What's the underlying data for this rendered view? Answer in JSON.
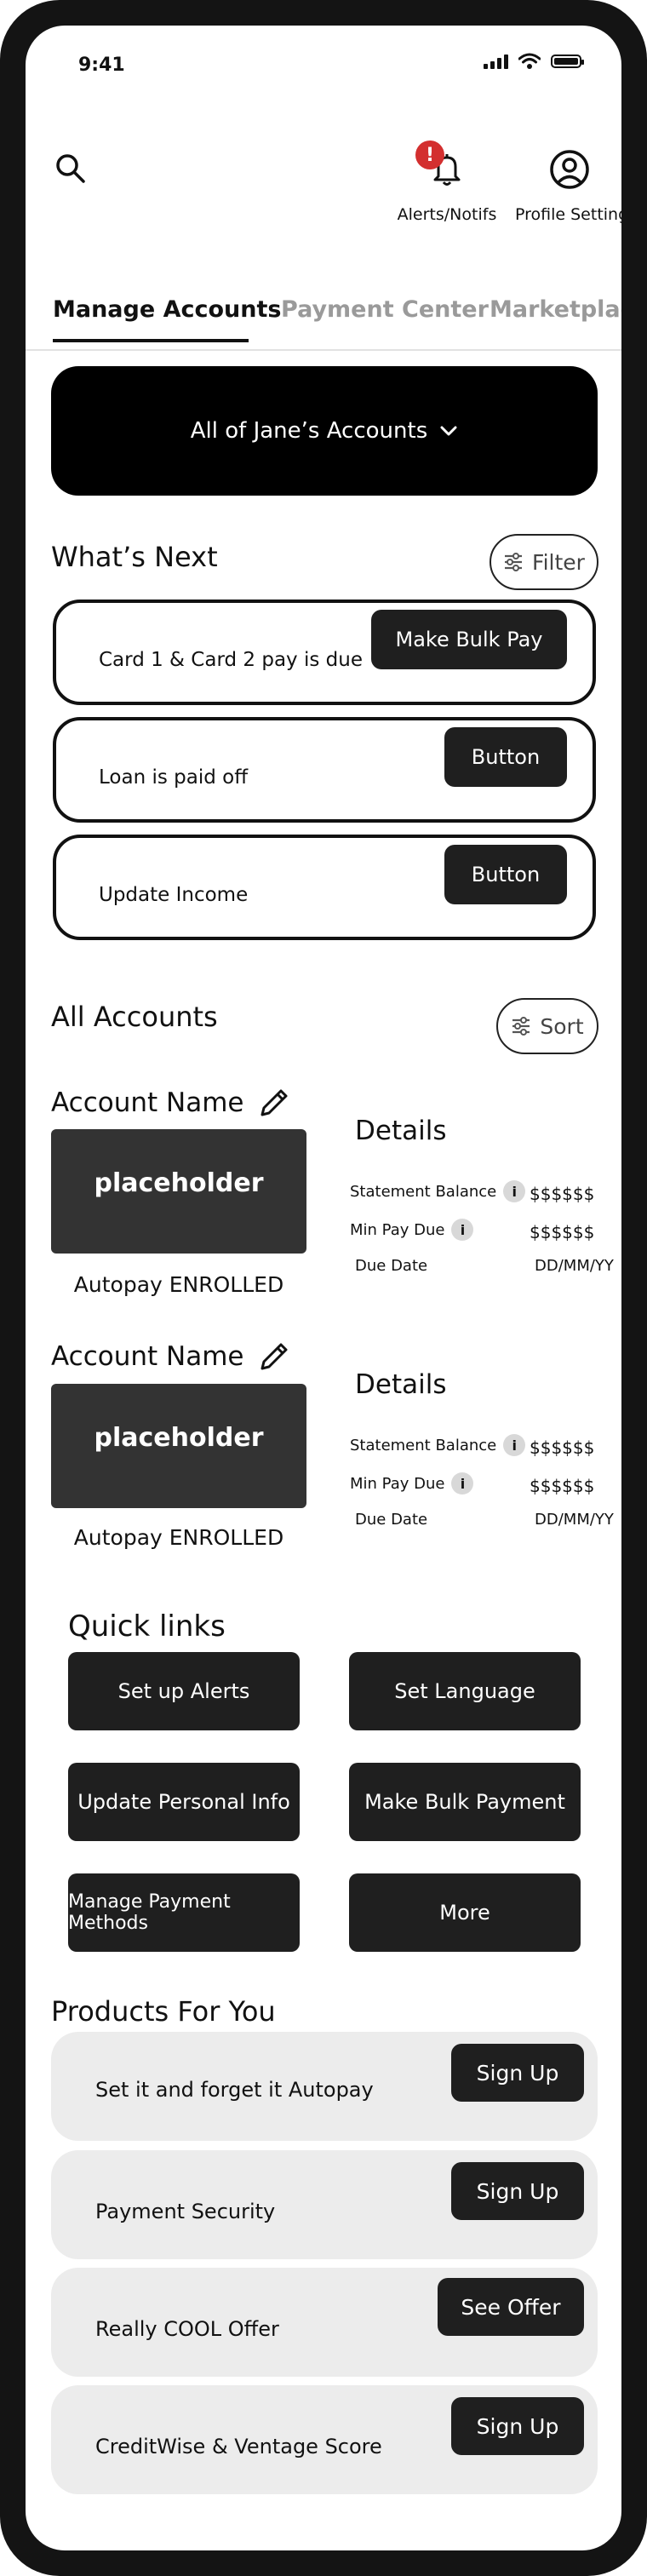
{
  "status_bar": {
    "time": "9:41"
  },
  "header": {
    "alerts_label": "Alerts/Notifs",
    "alerts_badge": "!",
    "profile_label": "Profile Settings"
  },
  "tabs": [
    {
      "label": "Manage Accounts"
    },
    {
      "label": "Payment Center"
    },
    {
      "label": "Marketplace"
    }
  ],
  "account_selector": {
    "label": "All of Jane’s Accounts"
  },
  "whats_next": {
    "title": "What’s Next",
    "filter_label": "Filter",
    "items": [
      {
        "text": "Card 1 & Card 2 pay is due",
        "button": "Make Bulk Pay"
      },
      {
        "text": "Loan is paid off",
        "button": "Button"
      },
      {
        "text": "Update Income",
        "button": "Button"
      }
    ]
  },
  "all_accounts": {
    "title": "All Accounts",
    "sort_label": "Sort",
    "accounts": [
      {
        "name": "Account Name",
        "image_text": "placeholder",
        "autopay": "Autopay ENROLLED",
        "details_title": "Details",
        "rows": [
          {
            "label": "Statement Balance",
            "value": "$$$$$$"
          },
          {
            "label": "Min Pay Due",
            "value": "$$$$$$"
          },
          {
            "label": "Due Date",
            "value": "DD/MM/YY"
          }
        ]
      },
      {
        "name": "Account Name",
        "image_text": "placeholder",
        "autopay": "Autopay ENROLLED",
        "details_title": "Details",
        "rows": [
          {
            "label": "Statement Balance",
            "value": "$$$$$$"
          },
          {
            "label": "Min Pay Due",
            "value": "$$$$$$"
          },
          {
            "label": "Due Date",
            "value": "DD/MM/YY"
          }
        ]
      }
    ]
  },
  "quick_links": {
    "title": "Quick links",
    "items": [
      "Set up Alerts",
      "Set Language",
      "Update Personal Info",
      "Make Bulk Payment",
      "Manage Payment Methods",
      "More"
    ]
  },
  "products": {
    "title": "Products For You",
    "items": [
      {
        "text": "Set it and forget it Autopay",
        "button": "Sign Up"
      },
      {
        "text": "Payment Security",
        "button": "Sign Up"
      },
      {
        "text": "Really COOL Offer",
        "button": "See Offer"
      },
      {
        "text": "CreditWise & Ventage Score",
        "button": "Sign Up"
      }
    ]
  },
  "colors": {
    "badge": "#d32f2f",
    "dark": "#1f1f1f",
    "product_bg": "#ececec"
  },
  "icons": [
    "search-icon",
    "bell-icon",
    "profile-icon",
    "chevron-down-icon",
    "filter-icon",
    "sort-icon",
    "pencil-icon",
    "info-icon"
  ]
}
